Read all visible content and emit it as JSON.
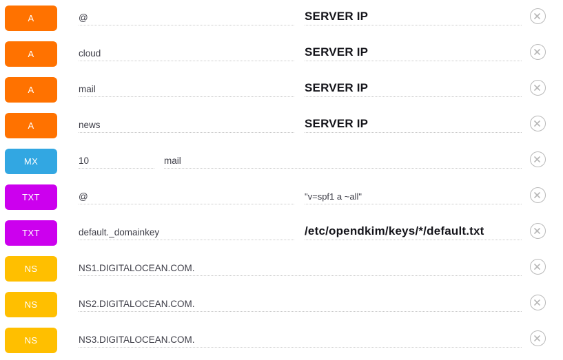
{
  "colors": {
    "a_record": "#ff7200",
    "mx_record": "#32a7e2",
    "txt_record": "#cc00ee",
    "ns_record": "#ffbf00",
    "field_underline": "#c8c8c8",
    "delete_icon": "#b9b9b9"
  },
  "delete_icon_name": "remove-record-icon",
  "records": [
    {
      "type": "A",
      "type_class": "t-a",
      "layout": "name-value",
      "name": "@",
      "name_style": "name",
      "value": "SERVER IP",
      "value_style": "strong"
    },
    {
      "type": "A",
      "type_class": "t-a",
      "layout": "name-value",
      "name": "cloud",
      "name_style": "name",
      "value": "SERVER IP",
      "value_style": "strong"
    },
    {
      "type": "A",
      "type_class": "t-a",
      "layout": "name-value",
      "name": "mail",
      "name_style": "name",
      "value": "SERVER IP",
      "value_style": "strong"
    },
    {
      "type": "A",
      "type_class": "t-a",
      "layout": "name-value",
      "name": "news",
      "name_style": "name",
      "value": "SERVER IP",
      "value_style": "strong"
    },
    {
      "type": "MX",
      "type_class": "t-mx",
      "layout": "priority-host",
      "priority": "10",
      "priority_style": "name",
      "host": "mail",
      "host_style": "name"
    },
    {
      "type": "TXT",
      "type_class": "t-txt",
      "layout": "name-value",
      "name": "@",
      "name_style": "name",
      "value": "\"v=spf1 a ~all\"",
      "value_style": "small"
    },
    {
      "type": "TXT",
      "type_class": "t-txt",
      "layout": "name-value",
      "name": "default._domainkey",
      "name_style": "name",
      "value": "/etc/opendkim/keys/*/default.txt",
      "value_style": "strong"
    },
    {
      "type": "NS",
      "type_class": "t-ns",
      "layout": "full",
      "hostname": "NS1.DIGITALOCEAN.COM.",
      "hostname_style": "name"
    },
    {
      "type": "NS",
      "type_class": "t-ns",
      "layout": "full",
      "hostname": "NS2.DIGITALOCEAN.COM.",
      "hostname_style": "name"
    },
    {
      "type": "NS",
      "type_class": "t-ns",
      "layout": "full",
      "hostname": "NS3.DIGITALOCEAN.COM.",
      "hostname_style": "name"
    }
  ]
}
